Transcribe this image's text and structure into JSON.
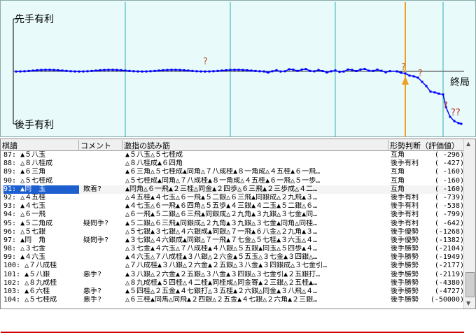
{
  "graph": {
    "label_top": "先手有利",
    "label_bottom": "後手有利",
    "label_end": "終局",
    "marks": [
      "?",
      "?",
      "?",
      "?",
      "??"
    ],
    "colors": {
      "line": "#0000ff",
      "bg": "#e8fafa",
      "cursor": "#f0a020",
      "mark": "#c03030"
    }
  },
  "table": {
    "headers": [
      "棋譜",
      "コメント",
      "激指の読み筋",
      "形勢判断（評価値）"
    ],
    "rows": [
      {
        "move": "87: ▲５八玉",
        "comment": "",
        "pv": "▲５八玉△５七桂成",
        "judge": "互角",
        "value": "( -296)"
      },
      {
        "move": "88: △８八桂成",
        "comment": "",
        "pv": "△８八桂成▲６四角",
        "judge": "後手有利",
        "value": "( -427)"
      },
      {
        "move": "89: ▲６三角",
        "comment": "",
        "pv": "▲６三角△５七桂成▲同角△７八成桂▲８一角成△４五桂▲６一飛…",
        "judge": "互角",
        "value": "( -160)"
      },
      {
        "move": "90: △５七桂成",
        "comment": "",
        "pv": "△５七桂成▲同角△７八成桂▲８一角成△４五桂▲６一飛△５一歩…",
        "judge": "互角",
        "value": "( -160)"
      },
      {
        "move": "91: ▲同　玉",
        "comment": "敗着?",
        "pv": "▲同角△６一飛▲２三桂△同金▲２四歩△６三飛▲２三歩成△４二…",
        "judge": "互角",
        "value": "( -160)"
      },
      {
        "move": "92: △４五桂",
        "comment": "",
        "pv": "△４五桂▲４七玉△６一飛▲５二銀△６三飛▲同銀成△２九飛▲３…",
        "judge": "後手有利",
        "value": "( -739)"
      },
      {
        "move": "93: ▲４七玉",
        "comment": "",
        "pv": "▲４七玉△６一飛▲６四角△５五歩▲４三銀▲４二玉▲５二銀△６…",
        "judge": "後手有利",
        "value": "( -538)"
      },
      {
        "move": "94: △６一飛",
        "comment": "",
        "pv": "△６一飛▲５二銀△６三飛▲同銀成△２九角▲３九銀△３七金▲同…",
        "judge": "後手有利",
        "value": "( -799)"
      },
      {
        "move": "95: ▲５二角成",
        "comment": "疑問手?",
        "pv": "▲５二銀△６三飛▲同銀成△２九角▲３九銀△３七金▲同角△同桂…",
        "judge": "後手有利",
        "value": "( -642)"
      },
      {
        "move": "96: △５七銀",
        "comment": "",
        "pv": "△５七銀▲３七銀△４六銀成▲同銀△７一飛▲６八金△２九角▲３…",
        "judge": "後手優勢",
        "value": "(-1268)"
      },
      {
        "move": "97: ▲同　角",
        "comment": "疑問手?",
        "pv": "▲３七銀△４六銀成▲同銀△７一飛▲７七金△５七桂▲３六玉△４…",
        "judge": "後手優勢",
        "value": "(-1382)"
      },
      {
        "move": "98: △３七金",
        "comment": "",
        "pv": "△３七金▲４六玉△７八成桂▲４八銀△５五銀▲同玉△５四歩▲４…",
        "judge": "後手勝勢",
        "value": "(-2104)"
      },
      {
        "move": "99: ▲４六玉",
        "comment": "",
        "pv": "▲４六玉△７八成桂▲３八銀△２六金▲５五玉△３七金▲３四銀△…",
        "judge": "後手勝勢",
        "value": "(-1949)"
      },
      {
        "move": "100: △７八成桂",
        "comment": "",
        "pv": "△７八成桂▲３八銀△２六金▲２五銀△３八金▲３四銀成△３七金引…",
        "judge": "後手勝勢",
        "value": "(-2177)"
      },
      {
        "move": "101: ▲５八銀",
        "comment": "悪手?",
        "pv": "▲３八銀△２六金▲２五銀△３八金▲３四銀△３七金引▲２五銀打…",
        "judge": "後手勝勢",
        "value": "(-2119)"
      },
      {
        "move": "102: △８九成桂",
        "comment": "",
        "pv": "△８九成桂▲５四桂△４二桂▲同桂成△同金寄▲２三銀△２五桂▲…",
        "judge": "後手勝勢",
        "value": "(-4380)"
      },
      {
        "move": "103: ▲６六桂",
        "comment": "悪手?",
        "pv": "▲５四桂△２五金▲４七銀打△３五桂▲２六銀△同金▲３八飛△４…",
        "judge": "後手勝勢",
        "value": "(-4727)"
      },
      {
        "move": "104: △５七桂成",
        "comment": "悪手?",
        "pv": "△６三桂▲同馬△同飛▲２四銀△２五金▲４七銀△２六角▲２三銀…",
        "judge": "後手勝勢",
        "value": "(-50000)"
      }
    ]
  }
}
